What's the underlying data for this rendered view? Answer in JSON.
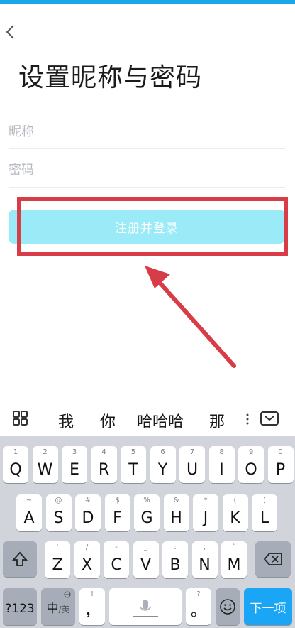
{
  "header": {
    "title": "设置昵称与密码"
  },
  "form": {
    "nickname_placeholder": "昵称",
    "password_placeholder": "密码",
    "submit_label": "注册并登录"
  },
  "keyboard": {
    "candidates": [
      "我",
      "你",
      "哈哈哈",
      "那"
    ],
    "row1": [
      {
        "main": "Q",
        "sub": "1"
      },
      {
        "main": "W",
        "sub": "2"
      },
      {
        "main": "E",
        "sub": "3"
      },
      {
        "main": "R",
        "sub": "4"
      },
      {
        "main": "T",
        "sub": "5"
      },
      {
        "main": "Y",
        "sub": "6"
      },
      {
        "main": "U",
        "sub": "7"
      },
      {
        "main": "I",
        "sub": "8"
      },
      {
        "main": "O",
        "sub": "9"
      },
      {
        "main": "P",
        "sub": "0"
      }
    ],
    "row2": [
      {
        "main": "A",
        "sub": "~"
      },
      {
        "main": "S",
        "sub": "@"
      },
      {
        "main": "D",
        "sub": "#"
      },
      {
        "main": "F",
        "sub": "$"
      },
      {
        "main": "G",
        "sub": "%"
      },
      {
        "main": "H",
        "sub": "&"
      },
      {
        "main": "J",
        "sub": "*"
      },
      {
        "main": "K",
        "sub": "("
      },
      {
        "main": "L",
        "sub": ")"
      }
    ],
    "row3": [
      {
        "main": "Z",
        "sub": "'"
      },
      {
        "main": "X",
        "sub": "/"
      },
      {
        "main": "C",
        "sub": "-"
      },
      {
        "main": "V",
        "sub": "_"
      },
      {
        "main": "B",
        "sub": ":"
      },
      {
        "main": "N",
        "sub": ";"
      },
      {
        "main": "M",
        "sub": "`"
      }
    ],
    "num_key": "?123",
    "lang_key": "中",
    "lang_key_sub": "/英",
    "comma_key": "，",
    "comma_key_sub": "!",
    "period_key": "。",
    "period_key_sub": "?",
    "next_key": "下一项"
  },
  "colors": {
    "submit_bg": "#9aeaf8",
    "highlight": "#d83c46",
    "accent": "#1aa6f5"
  }
}
